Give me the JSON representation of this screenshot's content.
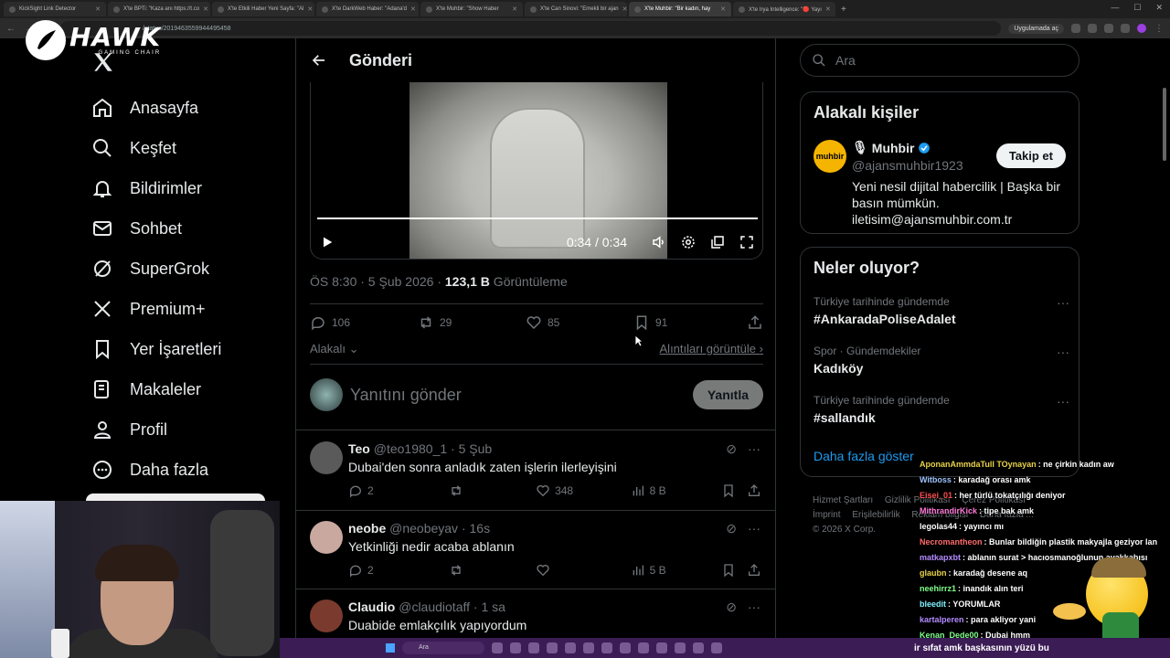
{
  "browser": {
    "tabs": [
      "KickSight Link Detector",
      "X'te BPTi: \"Kaza anı https://t.co",
      "X'te Etkili Haber Yeni Sayfa: \"Al",
      "X'te DarkWeb Haber: \"Adana'd",
      "X'te Muhbir: \"Show Haber",
      "X'te Can Sinovi: \"Emekli bir ajan",
      "X'te Muhbir: \"Bir kadın, hay",
      "X'te Irya Intelligence: \"🔴 Yayı"
    ],
    "url": "/status/2019463559944495458",
    "app_chip": "Uygulamada aç"
  },
  "overlay": {
    "brand": "HAWK",
    "brand_sub": "GAMING CHAIR",
    "ticker": "ir sıfat amk başkasının yüzü bu"
  },
  "nav": {
    "items": [
      {
        "label": "Anasayfa",
        "icon": "home-icon"
      },
      {
        "label": "Keşfet",
        "icon": "search-icon"
      },
      {
        "label": "Bildirimler",
        "icon": "bell-icon"
      },
      {
        "label": "Sohbet",
        "icon": "mail-icon"
      },
      {
        "label": "SuperGrok",
        "icon": "grok-icon"
      },
      {
        "label": "Premium+",
        "icon": "x-icon"
      },
      {
        "label": "Yer İşaretleri",
        "icon": "bookmark-icon"
      },
      {
        "label": "Makaleler",
        "icon": "article-icon"
      },
      {
        "label": "Profil",
        "icon": "user-icon"
      },
      {
        "label": "Daha fazla",
        "icon": "more-icon"
      }
    ]
  },
  "post": {
    "header_title": "Gönderi",
    "video_time": "0:34 / 0:34",
    "timestamp": "ÖS 8:30 · 5 Şub 2026 · ",
    "views": "123,1 B",
    "views_label": " Görüntüleme",
    "replies": "106",
    "reposts": "29",
    "likes": "85",
    "bookmarks": "91",
    "relevance": "Alakalı",
    "quotes_link": "Alıntıları görüntüle",
    "reply_placeholder": "Yanıtını gönder",
    "reply_button": "Yanıtla"
  },
  "replies": [
    {
      "name": "Teo",
      "handle": "@teo1980_1 · 5 Şub",
      "text": "Dubai'den sonra anladık zaten işlerin ilerleyişini",
      "replies": "2",
      "reposts": "",
      "likes": "348",
      "views": "8 B",
      "avatar_color": "#5a5a5a"
    },
    {
      "name": "neobe",
      "handle": "@neobeyav · 16s",
      "text": "Yetkinliği nedir acaba ablanın",
      "replies": "2",
      "reposts": "",
      "likes": "",
      "views": "5 B",
      "avatar_color": "#c9a8a0"
    },
    {
      "name": "Claudio",
      "handle": "@claudiotaff · 1 sa",
      "text": "Duabide emlakçılık yapıyordum",
      "replies": "",
      "reposts": "",
      "likes": "",
      "views": "",
      "avatar_color": "#7a3b2e"
    }
  ],
  "sidebar": {
    "search_placeholder": "Ara",
    "people_title": "Alakalı kişiler",
    "person": {
      "logo_text": "muhbir",
      "name": "Muhbir",
      "handle": "@ajansmuhbir1923",
      "bio": "Yeni nesil dijital habercilik | Başka bir basın mümkün. iletisim@ajansmuhbir.com.tr",
      "follow_label": "Takip et"
    },
    "trends_title": "Neler oluyor?",
    "trends": [
      {
        "context": "Türkiye tarihinde gündemde",
        "name": "#AnkaradaPoliseAdalet"
      },
      {
        "context": "Spor · Gündemdekiler",
        "name": "Kadıköy"
      },
      {
        "context": "Türkiye tarihinde gündemde",
        "name": "#sallandık"
      }
    ],
    "show_more": "Daha fazla göster",
    "footer": [
      "Hizmet Şartları",
      "Gizlilik Politikası",
      "Çerez Politikası",
      "İmprint",
      "Erişilebilirlik",
      "Reklam bilgisi",
      "Daha fazla ...",
      "© 2026 X Corp."
    ]
  },
  "chat": [
    {
      "user": "AponanAmmdaTull TOynayan",
      "color": "#e8d24a",
      "msg": ": ne çirkin kadın aw"
    },
    {
      "user": "Witboss",
      "color": "#9ec5ff",
      "msg": ": karadağ orası amk"
    },
    {
      "user": "Eisei_01",
      "color": "#ff4d4d",
      "msg": ": her türlü tokatçılığı deniyor"
    },
    {
      "user": "MithrandirKick",
      "color": "#ff7ad9",
      "msg": ": tipe bak amk"
    },
    {
      "user": "legolas44",
      "color": "#ffffff",
      "msg": ": yayıncı mı"
    },
    {
      "user": "Necromantheon",
      "color": "#ff6b6b",
      "msg": ": Bunlar bildiğin plastik makyajla geziyor lan"
    },
    {
      "user": "matkapxbt",
      "color": "#b48bff",
      "msg": ": ablanın surat > hacıosmanoğlunun ayakkabısı"
    },
    {
      "user": "glaubn",
      "color": "#e8d24a",
      "msg": ": karadağ desene aq"
    },
    {
      "user": "neehirrz1",
      "color": "#7fff8a",
      "msg": ": inandık alın teri"
    },
    {
      "user": "bleedit",
      "color": "#7ef0ff",
      "msg": ": YORUMLAR"
    },
    {
      "user": "kartalperen",
      "color": "#b48bff",
      "msg": ": para akliyor yani"
    },
    {
      "user": "Kenan_Dede00",
      "color": "#7fff8a",
      "msg": ": Dubai hmm"
    }
  ],
  "taskbar": {
    "search": "Ara"
  }
}
